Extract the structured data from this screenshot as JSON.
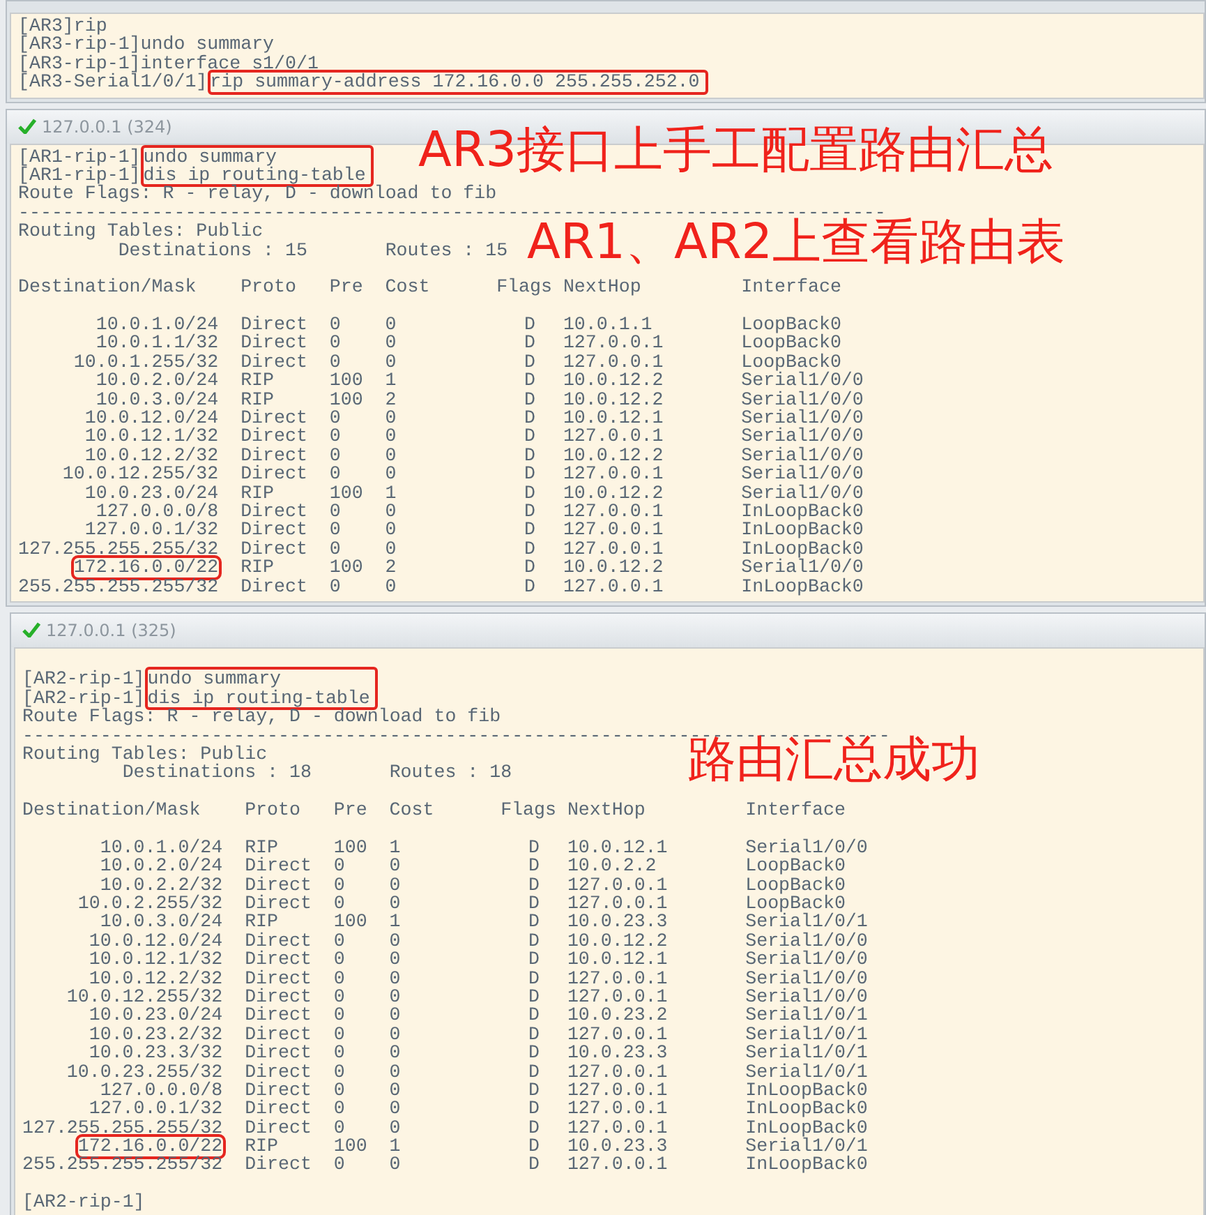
{
  "terminals": [
    {
      "blocks": [
        {
          "kind": "commands",
          "boxed": false,
          "items": [
            {
              "prompt": "[AR3]",
              "command": "rip"
            },
            {
              "prompt": "[AR3-rip-1]",
              "command": "undo summary"
            },
            {
              "prompt": "[AR3-rip-1]",
              "command": "interface s1/0/1"
            }
          ]
        },
        {
          "kind": "commands",
          "boxed": true,
          "items": [
            {
              "prompt": "[AR3-Serial1/0/1]",
              "command": "rip summary-address 172.16.0.0 255.255.252.0"
            }
          ]
        }
      ]
    },
    {
      "title": "127.0.0.1 (324)",
      "annotations": [
        "AR3接口上手工配置路由汇总",
        "AR1、AR2上查看路由表"
      ],
      "blocks": [
        {
          "kind": "commands",
          "boxed": true,
          "items": [
            {
              "prompt": "[AR1-rip-1]",
              "command": "undo summary"
            },
            {
              "prompt": "[AR1-rip-1]",
              "command": "dis ip routing-table"
            }
          ]
        },
        {
          "kind": "text",
          "text": "Route Flags: R - relay, D - download to fib"
        },
        {
          "kind": "text",
          "text": "------------------------------------------------------------------------------"
        },
        {
          "kind": "text",
          "text": "Routing Tables: Public"
        },
        {
          "kind": "text",
          "text": "         Destinations : 15       Routes : 15"
        },
        {
          "kind": "blank"
        },
        {
          "kind": "header",
          "cells": [
            "Destination/Mask",
            "Proto",
            "Pre",
            "Cost",
            "Flags",
            "NextHop",
            "Interface"
          ]
        },
        {
          "kind": "blank"
        },
        {
          "kind": "route",
          "boxed": false,
          "cells": [
            "10.0.1.0/24",
            "Direct",
            "0",
            "0",
            "D",
            "10.0.1.1",
            "LoopBack0"
          ]
        },
        {
          "kind": "route",
          "boxed": false,
          "cells": [
            "10.0.1.1/32",
            "Direct",
            "0",
            "0",
            "D",
            "127.0.0.1",
            "LoopBack0"
          ]
        },
        {
          "kind": "route",
          "boxed": false,
          "cells": [
            "10.0.1.255/32",
            "Direct",
            "0",
            "0",
            "D",
            "127.0.0.1",
            "LoopBack0"
          ]
        },
        {
          "kind": "route",
          "boxed": false,
          "cells": [
            "10.0.2.0/24",
            "RIP",
            "100",
            "1",
            "D",
            "10.0.12.2",
            "Serial1/0/0"
          ]
        },
        {
          "kind": "route",
          "boxed": false,
          "cells": [
            "10.0.3.0/24",
            "RIP",
            "100",
            "2",
            "D",
            "10.0.12.2",
            "Serial1/0/0"
          ]
        },
        {
          "kind": "route",
          "boxed": false,
          "cells": [
            "10.0.12.0/24",
            "Direct",
            "0",
            "0",
            "D",
            "10.0.12.1",
            "Serial1/0/0"
          ]
        },
        {
          "kind": "route",
          "boxed": false,
          "cells": [
            "10.0.12.1/32",
            "Direct",
            "0",
            "0",
            "D",
            "127.0.0.1",
            "Serial1/0/0"
          ]
        },
        {
          "kind": "route",
          "boxed": false,
          "cells": [
            "10.0.12.2/32",
            "Direct",
            "0",
            "0",
            "D",
            "10.0.12.2",
            "Serial1/0/0"
          ]
        },
        {
          "kind": "route",
          "boxed": false,
          "cells": [
            "10.0.12.255/32",
            "Direct",
            "0",
            "0",
            "D",
            "127.0.0.1",
            "Serial1/0/0"
          ]
        },
        {
          "kind": "route",
          "boxed": false,
          "cells": [
            "10.0.23.0/24",
            "RIP",
            "100",
            "1",
            "D",
            "10.0.12.2",
            "Serial1/0/0"
          ]
        },
        {
          "kind": "route",
          "boxed": false,
          "cells": [
            "127.0.0.0/8",
            "Direct",
            "0",
            "0",
            "D",
            "127.0.0.1",
            "InLoopBack0"
          ]
        },
        {
          "kind": "route",
          "boxed": false,
          "cells": [
            "127.0.0.1/32",
            "Direct",
            "0",
            "0",
            "D",
            "127.0.0.1",
            "InLoopBack0"
          ]
        },
        {
          "kind": "route",
          "boxed": false,
          "cells": [
            "127.255.255.255/32",
            "Direct",
            "0",
            "0",
            "D",
            "127.0.0.1",
            "InLoopBack0"
          ]
        },
        {
          "kind": "route",
          "boxed": true,
          "cells": [
            "172.16.0.0/22",
            "RIP",
            "100",
            "2",
            "D",
            "10.0.12.2",
            "Serial1/0/0"
          ]
        },
        {
          "kind": "route",
          "boxed": false,
          "cells": [
            "255.255.255.255/32",
            "Direct",
            "0",
            "0",
            "D",
            "127.0.0.1",
            "InLoopBack0"
          ]
        }
      ]
    },
    {
      "title": "127.0.0.1 (325)",
      "annotations": [
        "路由汇总成功"
      ],
      "blocks": [
        {
          "kind": "blank"
        },
        {
          "kind": "commands",
          "boxed": true,
          "items": [
            {
              "prompt": "[AR2-rip-1]",
              "command": "undo summary"
            },
            {
              "prompt": "[AR2-rip-1]",
              "command": "dis ip routing-table"
            }
          ]
        },
        {
          "kind": "text",
          "text": "Route Flags: R - relay, D - download to fib"
        },
        {
          "kind": "text",
          "text": "------------------------------------------------------------------------------"
        },
        {
          "kind": "text",
          "text": "Routing Tables: Public"
        },
        {
          "kind": "text",
          "text": "         Destinations : 18       Routes : 18"
        },
        {
          "kind": "blank"
        },
        {
          "kind": "header",
          "cells": [
            "Destination/Mask",
            "Proto",
            "Pre",
            "Cost",
            "Flags",
            "NextHop",
            "Interface"
          ]
        },
        {
          "kind": "blank"
        },
        {
          "kind": "route",
          "boxed": false,
          "cells": [
            "10.0.1.0/24",
            "RIP",
            "100",
            "1",
            "D",
            "10.0.12.1",
            "Serial1/0/0"
          ]
        },
        {
          "kind": "route",
          "boxed": false,
          "cells": [
            "10.0.2.0/24",
            "Direct",
            "0",
            "0",
            "D",
            "10.0.2.2",
            "LoopBack0"
          ]
        },
        {
          "kind": "route",
          "boxed": false,
          "cells": [
            "10.0.2.2/32",
            "Direct",
            "0",
            "0",
            "D",
            "127.0.0.1",
            "LoopBack0"
          ]
        },
        {
          "kind": "route",
          "boxed": false,
          "cells": [
            "10.0.2.255/32",
            "Direct",
            "0",
            "0",
            "D",
            "127.0.0.1",
            "LoopBack0"
          ]
        },
        {
          "kind": "route",
          "boxed": false,
          "cells": [
            "10.0.3.0/24",
            "RIP",
            "100",
            "1",
            "D",
            "10.0.23.3",
            "Serial1/0/1"
          ]
        },
        {
          "kind": "route",
          "boxed": false,
          "cells": [
            "10.0.12.0/24",
            "Direct",
            "0",
            "0",
            "D",
            "10.0.12.2",
            "Serial1/0/0"
          ]
        },
        {
          "kind": "route",
          "boxed": false,
          "cells": [
            "10.0.12.1/32",
            "Direct",
            "0",
            "0",
            "D",
            "10.0.12.1",
            "Serial1/0/0"
          ]
        },
        {
          "kind": "route",
          "boxed": false,
          "cells": [
            "10.0.12.2/32",
            "Direct",
            "0",
            "0",
            "D",
            "127.0.0.1",
            "Serial1/0/0"
          ]
        },
        {
          "kind": "route",
          "boxed": false,
          "cells": [
            "10.0.12.255/32",
            "Direct",
            "0",
            "0",
            "D",
            "127.0.0.1",
            "Serial1/0/0"
          ]
        },
        {
          "kind": "route",
          "boxed": false,
          "cells": [
            "10.0.23.0/24",
            "Direct",
            "0",
            "0",
            "D",
            "10.0.23.2",
            "Serial1/0/1"
          ]
        },
        {
          "kind": "route",
          "boxed": false,
          "cells": [
            "10.0.23.2/32",
            "Direct",
            "0",
            "0",
            "D",
            "127.0.0.1",
            "Serial1/0/1"
          ]
        },
        {
          "kind": "route",
          "boxed": false,
          "cells": [
            "10.0.23.3/32",
            "Direct",
            "0",
            "0",
            "D",
            "10.0.23.3",
            "Serial1/0/1"
          ]
        },
        {
          "kind": "route",
          "boxed": false,
          "cells": [
            "10.0.23.255/32",
            "Direct",
            "0",
            "0",
            "D",
            "127.0.0.1",
            "Serial1/0/1"
          ]
        },
        {
          "kind": "route",
          "boxed": false,
          "cells": [
            "127.0.0.0/8",
            "Direct",
            "0",
            "0",
            "D",
            "127.0.0.1",
            "InLoopBack0"
          ]
        },
        {
          "kind": "route",
          "boxed": false,
          "cells": [
            "127.0.0.1/32",
            "Direct",
            "0",
            "0",
            "D",
            "127.0.0.1",
            "InLoopBack0"
          ]
        },
        {
          "kind": "route",
          "boxed": false,
          "cells": [
            "127.255.255.255/32",
            "Direct",
            "0",
            "0",
            "D",
            "127.0.0.1",
            "InLoopBack0"
          ]
        },
        {
          "kind": "route",
          "boxed": true,
          "cells": [
            "172.16.0.0/22",
            "RIP",
            "100",
            "1",
            "D",
            "10.0.23.3",
            "Serial1/0/1"
          ]
        },
        {
          "kind": "route",
          "boxed": false,
          "cells": [
            "255.255.255.255/32",
            "Direct",
            "0",
            "0",
            "D",
            "127.0.0.1",
            "InLoopBack0"
          ]
        },
        {
          "kind": "blank"
        },
        {
          "kind": "text",
          "text": "[AR2-rip-1]"
        }
      ]
    }
  ]
}
